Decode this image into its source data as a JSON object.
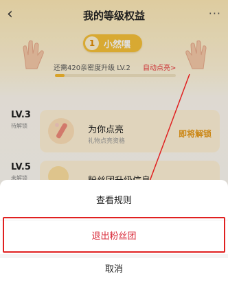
{
  "nav": {
    "back_icon": "back-chevron-icon",
    "title": "我的等级权益",
    "more_icon": "more-dots-icon",
    "more_glyph": "···"
  },
  "level_badge": {
    "number": "1",
    "name": "小然嘿"
  },
  "progress": {
    "text": "还需420亲密度升级 LV.2",
    "link": "自动点亮>",
    "fraction": 0.08
  },
  "levels": [
    {
      "level": "LV.3",
      "status": "待解锁",
      "benefit_title": "为你点亮",
      "benefit_sub": "礼物点亮资格",
      "benefit_status": "即将解锁"
    },
    {
      "level": "LV.5",
      "status": "未解锁",
      "benefit_title": "粉丝团升级信息"
    }
  ],
  "action_sheet": {
    "rules": "查看规则",
    "exit": "退出粉丝团",
    "cancel": "取消"
  },
  "colors": {
    "accent_red": "#d92b3a",
    "highlight_border": "#e02020",
    "badge_gold": "#f6c13a",
    "status_orange": "#e89a1a"
  }
}
